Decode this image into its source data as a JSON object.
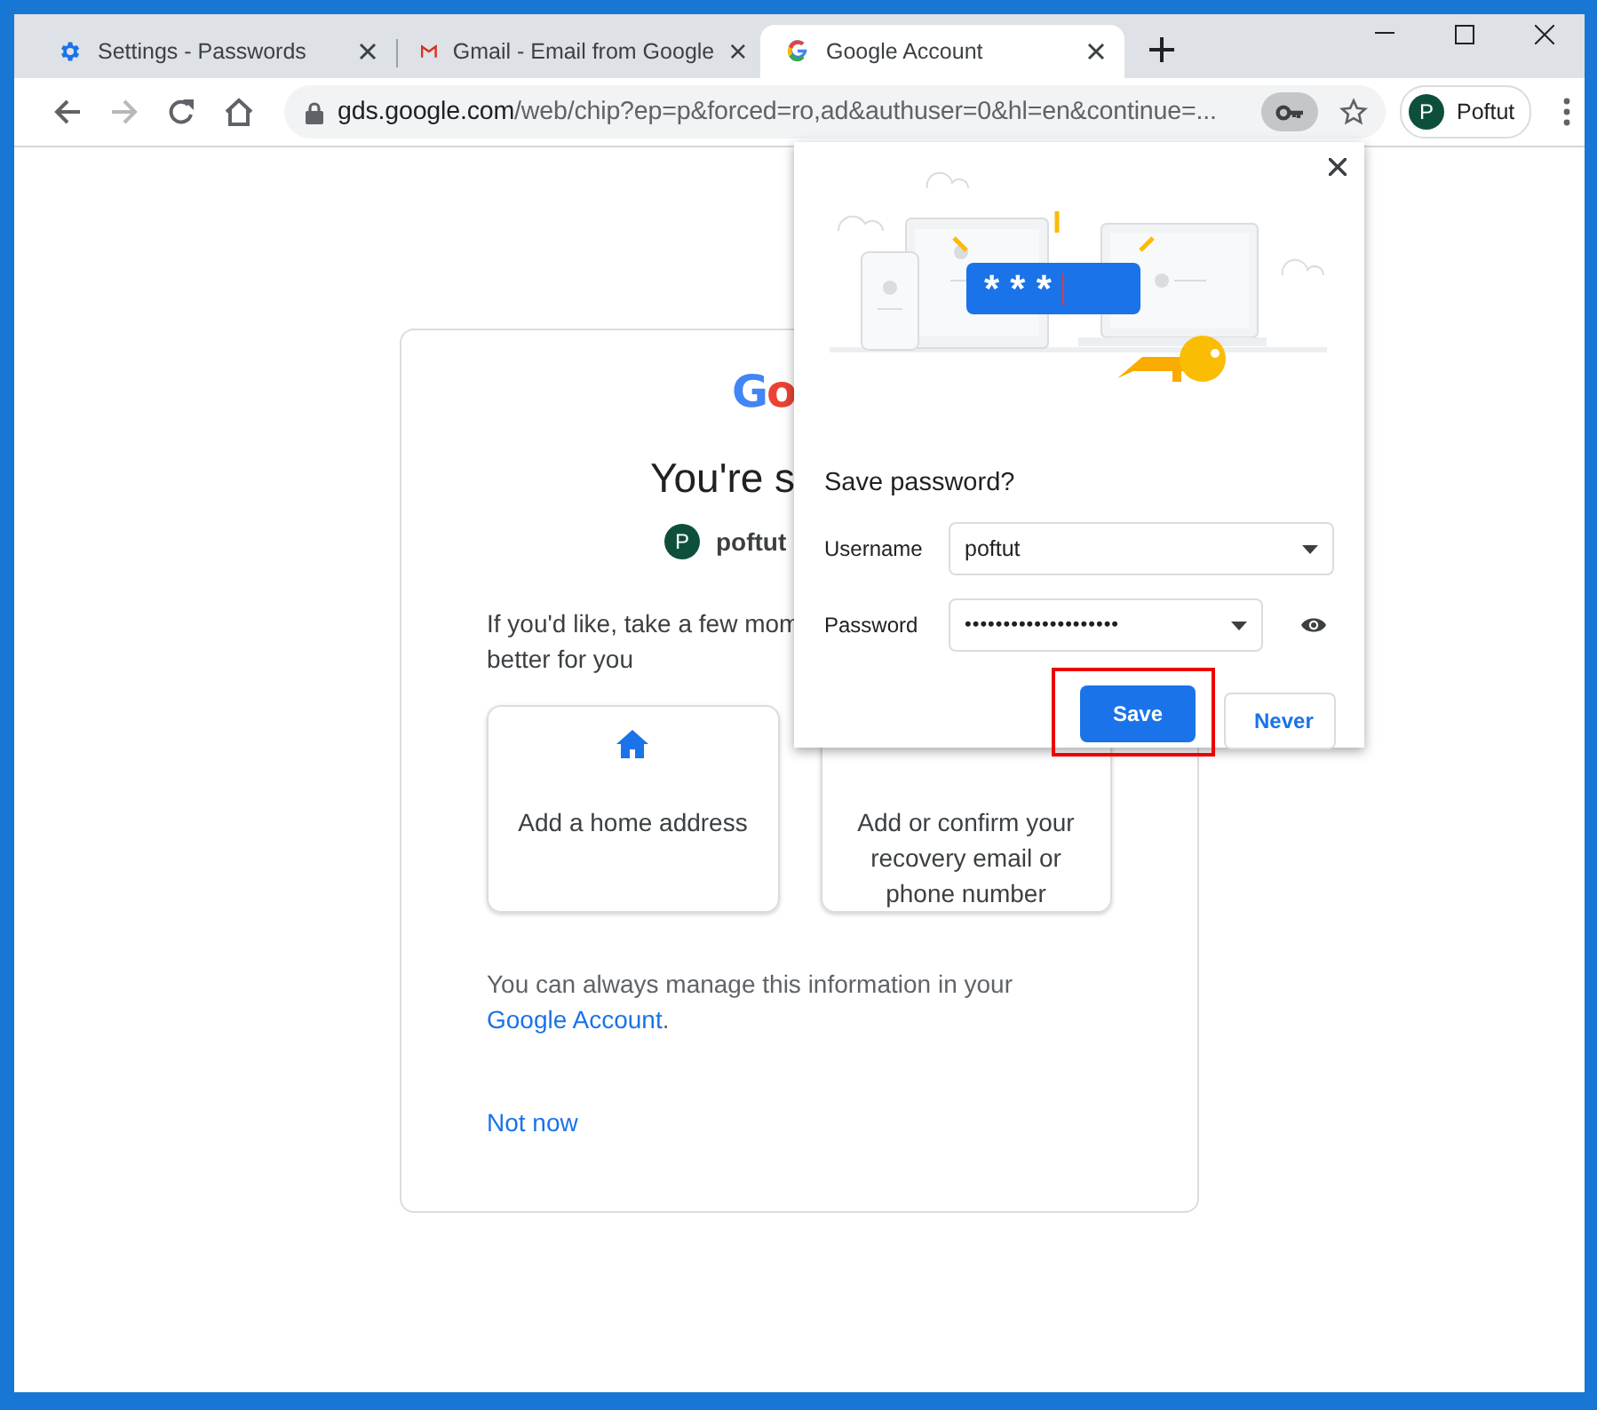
{
  "tabs": [
    {
      "title": "Settings - Passwords",
      "kind": "settings",
      "selected": false
    },
    {
      "title": "Gmail - Email from Google",
      "kind": "mail",
      "selected": false
    },
    {
      "title": "Google Account",
      "kind": "google",
      "selected": true
    }
  ],
  "toolbar": {
    "back": {
      "disabled": false
    },
    "forward": {
      "disabled": true
    },
    "address": {
      "domain": "gds.google.com",
      "path": "/web/chip?ep=p&forced=ro,ad&authuser=0&hl=en&continue=..."
    },
    "key_active": true,
    "profile": {
      "initial": "P",
      "name": "Poftut"
    }
  },
  "page": {
    "logo": "Go",
    "heading": "You're s",
    "account": {
      "initial": "P",
      "name": "poftut"
    },
    "intro_lines": [
      "If you'd like, take a few mom",
      "better for you"
    ],
    "options": [
      {
        "label": "Add a home address",
        "kind": "home"
      },
      {
        "label": "Add or confirm your recovery email or phone number",
        "kind": "covered"
      }
    ],
    "note": "You can always manage this information in your",
    "note_link": "Google Account",
    "note_end": ".",
    "not_now": "Not now"
  },
  "popup": {
    "masked_text": "* * *",
    "title": "Save password?",
    "fields": [
      {
        "label": "Username",
        "value": "poftut",
        "kind": "text"
      },
      {
        "label": "Password",
        "value": "••••••••••••••••••••",
        "kind": "password"
      }
    ],
    "buttons": [
      {
        "label": "Save",
        "primary": true,
        "highlighted": true
      },
      {
        "label": "Never",
        "primary": false,
        "highlighted": false
      }
    ]
  }
}
